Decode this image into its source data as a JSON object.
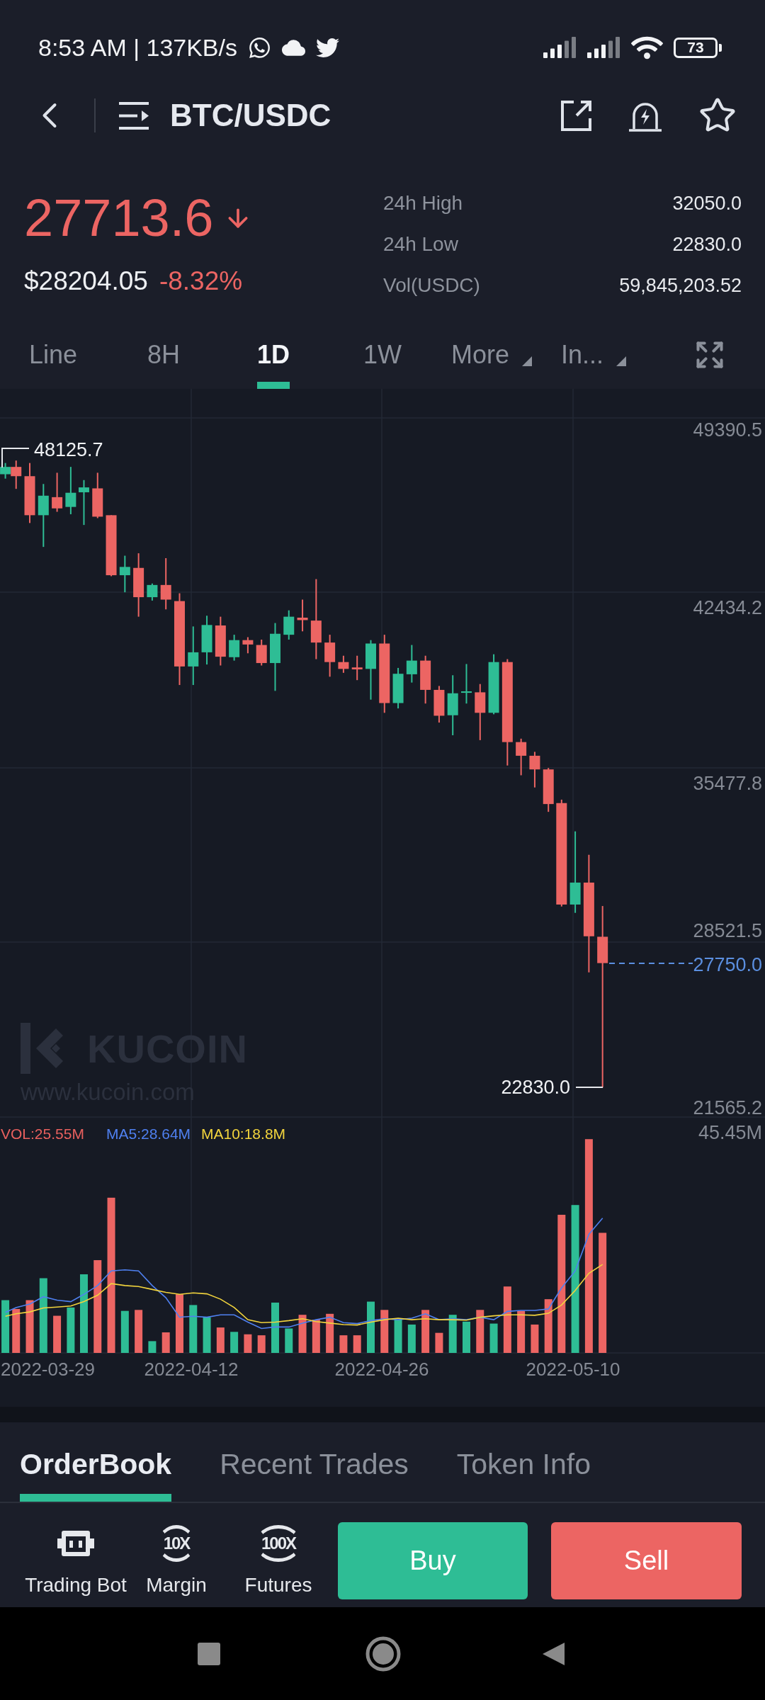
{
  "status_bar": {
    "text": "8:53 AM | 137KB/s",
    "battery": "73"
  },
  "header": {
    "title": "BTC/USDC"
  },
  "ticker": {
    "price": "27713.6",
    "falling": true,
    "fiat_price": "$28204.05",
    "change": "-8.32%"
  },
  "stats": [
    {
      "label": "24h High",
      "value": "32050.0"
    },
    {
      "label": "24h Low",
      "value": "22830.0"
    },
    {
      "label": "Vol(USDC)",
      "value": "59,845,203.52"
    }
  ],
  "interval_tabs": [
    {
      "label": "Line",
      "kind": "tab",
      "selected": false
    },
    {
      "label": "8H",
      "kind": "tab",
      "selected": false
    },
    {
      "label": "1D",
      "kind": "tab",
      "selected": true
    },
    {
      "label": "1W",
      "kind": "tab",
      "selected": false
    },
    {
      "label": "More",
      "kind": "dropdown",
      "selected": false
    },
    {
      "label": "In...",
      "kind": "dropdown",
      "selected": false
    }
  ],
  "chart": {
    "price_axis": [
      "49390.5",
      "42434.2",
      "35477.8",
      "28521.5",
      "21565.2"
    ],
    "high_label": "48125.7",
    "low_label": "22830.0",
    "last_price_label": "27750.0",
    "watermark": {
      "brand": "KUCOIN",
      "url": "www.kucoin.com"
    },
    "volume_legend": [
      {
        "label": "VOL:25.55M",
        "color": "#e8605e"
      },
      {
        "label": "MA5:28.64M",
        "color": "#4f80f0"
      },
      {
        "label": "MA10:18.8M",
        "color": "#f2d43d"
      }
    ],
    "volume_axis": "45.45M",
    "date_axis": [
      "2022-03-29",
      "2022-04-12",
      "2022-04-26",
      "2022-05-10"
    ]
  },
  "bottom_tabs": [
    {
      "label": "OrderBook",
      "selected": true
    },
    {
      "label": "Recent Trades",
      "selected": false
    },
    {
      "label": "Token Info",
      "selected": false
    }
  ],
  "tools": [
    {
      "label": "Trading Bot",
      "kind": "bot"
    },
    {
      "label": "Margin",
      "kind": "leverage",
      "badge": "10X"
    },
    {
      "label": "Futures",
      "kind": "leverage",
      "badge": "100X"
    }
  ],
  "actions": [
    {
      "label": "Buy",
      "kind": "buy"
    },
    {
      "label": "Sell",
      "kind": "sell"
    }
  ]
}
